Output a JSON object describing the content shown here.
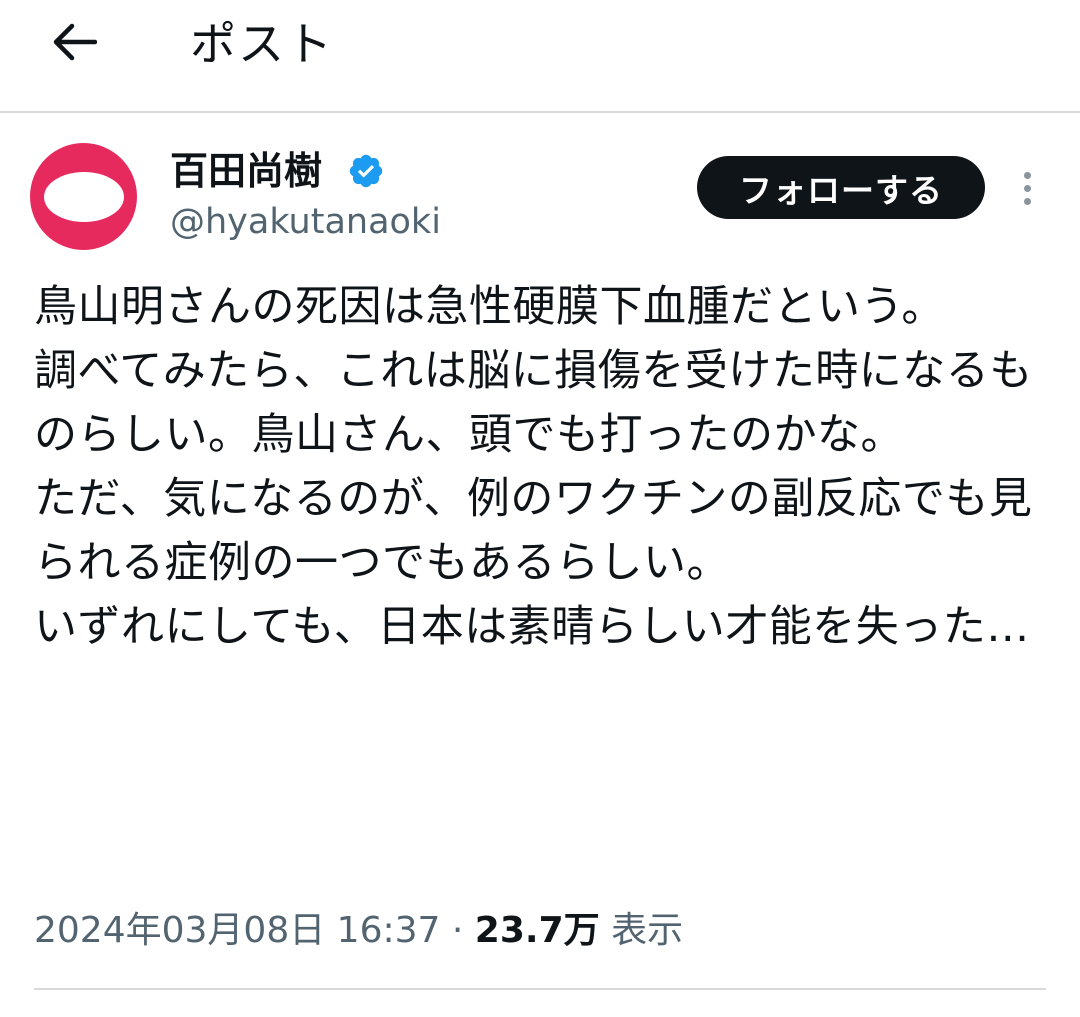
{
  "header": {
    "title": "ポスト",
    "back_icon": "arrow-left-icon"
  },
  "author": {
    "display_name": "百田尚樹",
    "handle": "@hyakutanaoki",
    "verified_icon": "verified-badge-icon",
    "avatar_color": "#e72a5e",
    "verified_color": "#1d9bf0"
  },
  "actions": {
    "follow_label": "フォローする",
    "more_icon": "more-vertical-icon"
  },
  "tweet": {
    "text": "鳥山明さんの死因は急性硬膜下血腫だという。\n調べてみたら、これは脳に損傷を受けた時になるものらしい。鳥山さん、頭でも打ったのかな。\nただ、気になるのが、例のワクチンの副反応でも見られる症例の一つでもあるらしい。\nいずれにしても、日本は素晴らしい才能を失った…"
  },
  "meta": {
    "timestamp": "2024年03月08日 16:37",
    "separator": "·",
    "views_count": "23.7万",
    "views_label": "表示"
  }
}
